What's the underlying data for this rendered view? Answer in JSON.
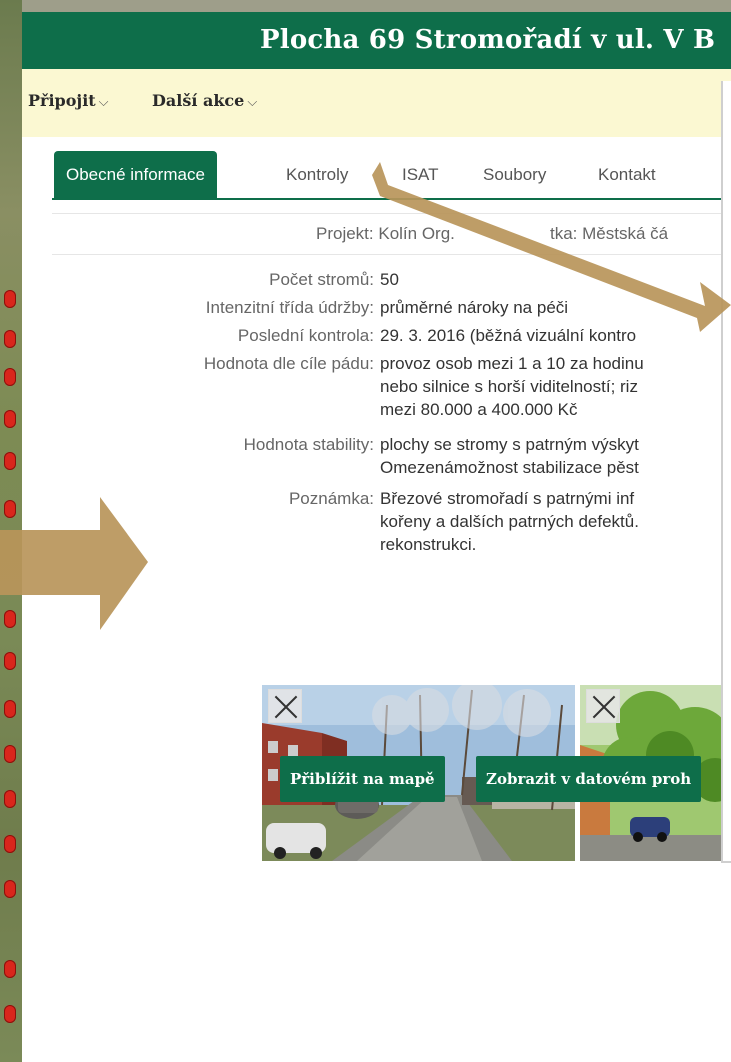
{
  "header": {
    "title": "Plocha 69 Stromořadí v ul. V B"
  },
  "actionbar": {
    "connect_label": "Připojit",
    "more_label": "Další akce",
    "chevron": "⌵"
  },
  "tabs": [
    {
      "label": "Obecné informace"
    },
    {
      "label": "Kontroly"
    },
    {
      "label": "ISAT"
    },
    {
      "label": "Soubory"
    },
    {
      "label": "Kontakt"
    }
  ],
  "project": {
    "text_left": "Projekt: Kolín Org.",
    "text_right": "tka: Městská čá"
  },
  "info": {
    "tree_count": {
      "label": "Počet stromů:",
      "value": "50"
    },
    "maintenance": {
      "label": "Intenzitní třída údržby:",
      "value": "průměrné nároky na péči"
    },
    "last_check": {
      "label": "Poslední kontrola:",
      "value": "29. 3. 2016 (běžná vizuální kontro"
    },
    "fall_target": {
      "label": "Hodnota dle cíle pádu:",
      "lines": [
        "provoz osob mezi 1 a 10 za hodinu",
        "nebo silnice s horší viditelností; riz",
        "mezi 80.000 a 400.000 Kč"
      ]
    },
    "stability": {
      "label": "Hodnota stability:",
      "lines": [
        "plochy se stromy s patrným výskyt",
        "Omezenámožnost stabilizace pěst"
      ]
    },
    "note": {
      "label": "Poznámka:",
      "lines": [
        "Březové stromořadí s patrnými inf",
        "kořeny a dalších patrných defektů.",
        "rekonstrukci."
      ]
    }
  },
  "buttons": {
    "zoom_map": "Přiblížit na mapě",
    "show_data": "Zobrazit v datovém proh"
  },
  "colors": {
    "brand_green": "#0e6e4a",
    "actionbar_bg": "#fbf8d2",
    "annotation_arrow": "#b8955a"
  }
}
